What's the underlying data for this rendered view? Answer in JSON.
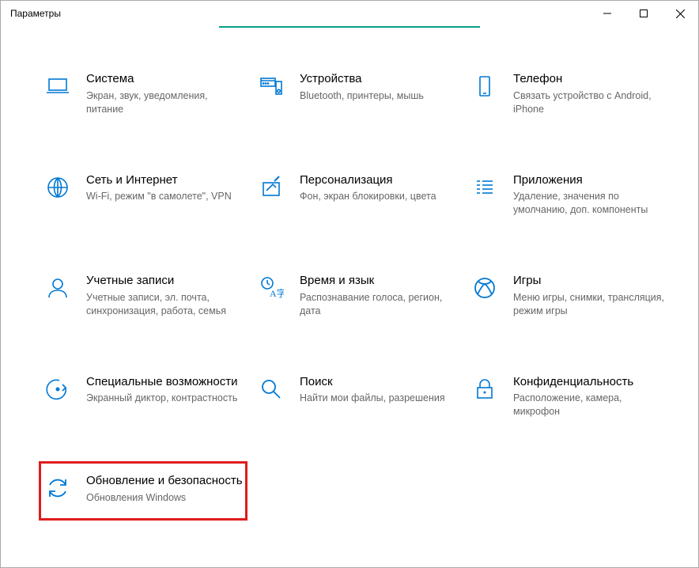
{
  "window": {
    "title": "Параметры"
  },
  "tiles": [
    {
      "id": "system",
      "title": "Система",
      "desc": "Экран, звук, уведомления, питание"
    },
    {
      "id": "devices",
      "title": "Устройства",
      "desc": "Bluetooth, принтеры, мышь"
    },
    {
      "id": "phone",
      "title": "Телефон",
      "desc": "Связать устройство с Android, iPhone"
    },
    {
      "id": "network",
      "title": "Сеть и Интернет",
      "desc": "Wi-Fi, режим \"в самолете\", VPN"
    },
    {
      "id": "personalization",
      "title": "Персонализация",
      "desc": "Фон, экран блокировки, цвета"
    },
    {
      "id": "apps",
      "title": "Приложения",
      "desc": "Удаление, значения по умолчанию, доп. компоненты"
    },
    {
      "id": "accounts",
      "title": "Учетные записи",
      "desc": "Учетные записи, эл. почта, синхронизация, работа, семья"
    },
    {
      "id": "time-language",
      "title": "Время и язык",
      "desc": "Распознавание голоса, регион, дата"
    },
    {
      "id": "gaming",
      "title": "Игры",
      "desc": "Меню игры, снимки, трансляция, режим игры"
    },
    {
      "id": "accessibility",
      "title": "Специальные возможности",
      "desc": "Экранный диктор, контрастность"
    },
    {
      "id": "search",
      "title": "Поиск",
      "desc": "Найти мои файлы, разрешения"
    },
    {
      "id": "privacy",
      "title": "Конфиденциальность",
      "desc": "Расположение, камера, микрофон"
    },
    {
      "id": "update-security",
      "title": "Обновление и безопасность",
      "desc": "Обновления Windows"
    }
  ],
  "highlighted_id": "update-security",
  "accent_color": "#0078d4"
}
